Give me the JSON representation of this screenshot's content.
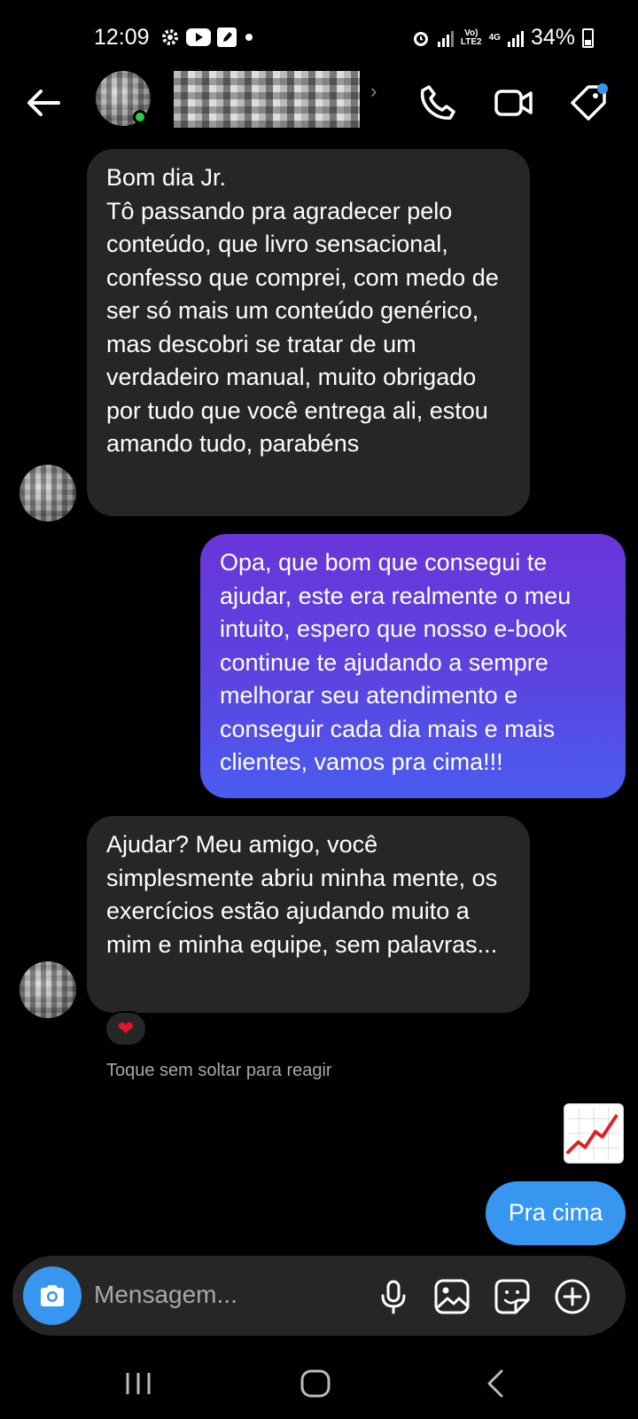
{
  "status_bar": {
    "time": "12:09",
    "network_label_top": "Vo)",
    "network_label_bottom": "LTE2",
    "network_gen": "4G",
    "battery": "34%"
  },
  "header": {
    "back_icon": "arrow-left-icon",
    "call_icon": "phone-icon",
    "video_icon": "video-camera-icon",
    "tag_icon": "tag-icon"
  },
  "messages": [
    {
      "direction": "received",
      "text": "Bom dia Jr.\nTô passando pra agradecer pelo conteúdo, que livro sensacional, confesso que comprei, com medo de ser só mais um conteúdo genérico, mas descobri se tratar de um verdadeiro manual, muito obrigado por tudo que você entrega ali, estou amando tudo, parabéns"
    },
    {
      "direction": "sent",
      "text": "Opa, que bom que consegui te ajudar, este era realmente o meu intuito, espero que nosso e-book continue te ajudando a sempre melhorar seu atendimento e conseguir cada dia mais e mais clientes, vamos pra cima!!!"
    },
    {
      "direction": "received",
      "text": "Ajudar? Meu amigo, você simplesmente abriu minha mente, os exercícios estão ajudando muito a mim e minha equipe, sem palavras...",
      "reaction": "❤"
    },
    {
      "direction": "sent",
      "sticker": "chart-increasing-icon"
    },
    {
      "direction": "sent",
      "text": "Pra cima"
    }
  ],
  "reaction_hint": "Toque sem soltar para reagir",
  "composer": {
    "placeholder": "Mensagem...",
    "icons": [
      "camera-icon",
      "microphone-icon",
      "image-icon",
      "sticker-icon",
      "plus-icon"
    ]
  },
  "colors": {
    "background": "#000000",
    "received_bubble": "#262626",
    "sent_gradient_top": "#6a35d9",
    "sent_gradient_bottom": "#4a5cf0",
    "accent_blue": "#3797f0",
    "online": "#2ecc40",
    "reaction_heart": "#e8142c"
  }
}
